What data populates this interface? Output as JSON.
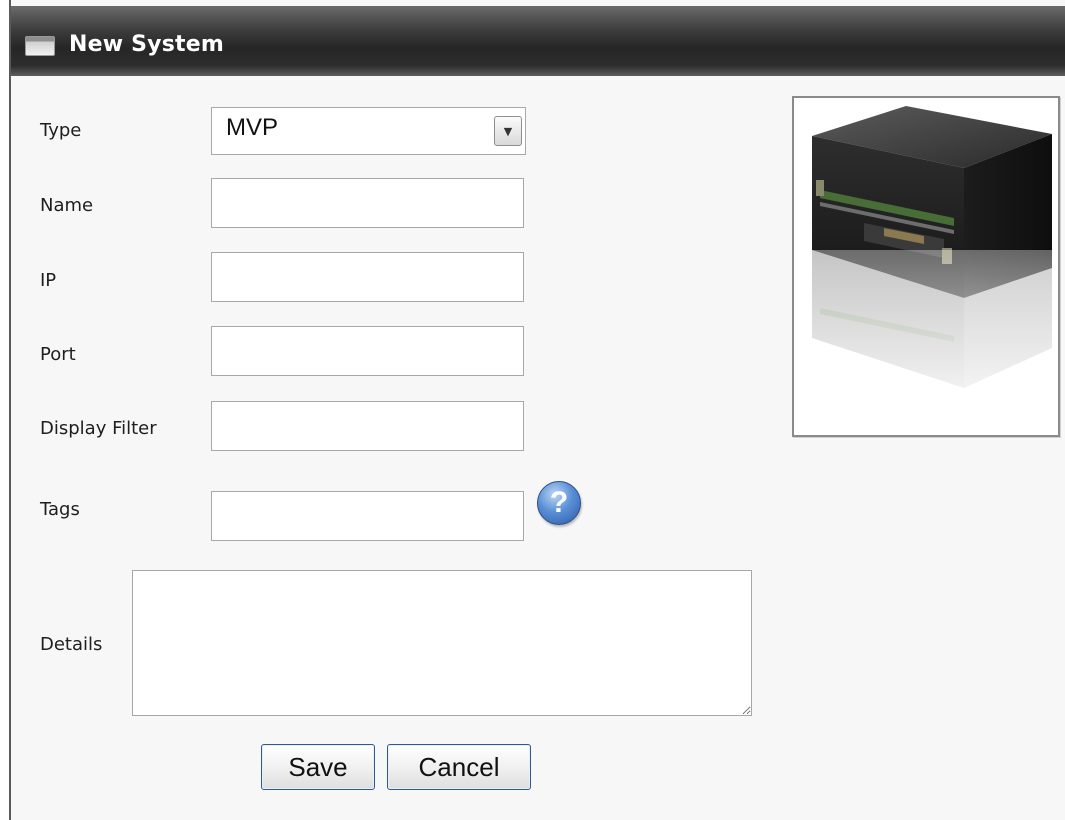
{
  "window": {
    "title": "New System",
    "title_icon": "window-icon"
  },
  "form": {
    "type": {
      "label": "Type",
      "value": "MVP",
      "options_visible": [
        "MVP"
      ]
    },
    "name": {
      "label": "Name",
      "value": ""
    },
    "ip": {
      "label": "IP",
      "value": ""
    },
    "port": {
      "label": "Port",
      "value": ""
    },
    "display_filter": {
      "label": "Display Filter",
      "value": ""
    },
    "tags": {
      "label": "Tags",
      "value": "",
      "help_icon": "help-icon"
    },
    "details": {
      "label": "Details",
      "value": ""
    }
  },
  "buttons": {
    "save": "Save",
    "cancel": "Cancel"
  },
  "preview": {
    "image": "system-hardware-image"
  },
  "colors": {
    "titlebar": "#2b2b2b",
    "button_border": "#2f5a8f",
    "help_icon": "#3d74c4"
  }
}
